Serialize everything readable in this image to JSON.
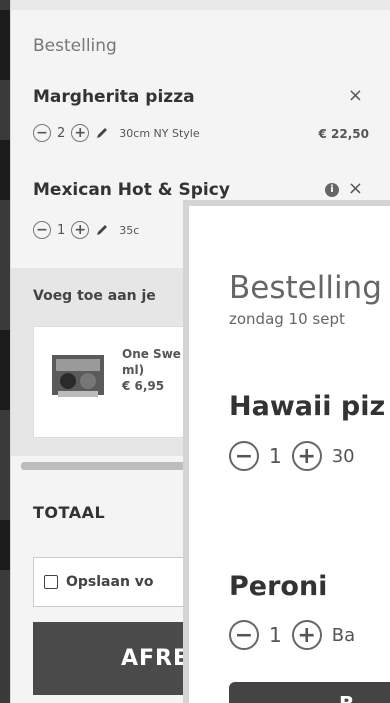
{
  "order": {
    "title": "Bestelling",
    "items": [
      {
        "name": "Margherita pizza",
        "remove": "×",
        "qty": "2",
        "size": "30cm NY Style",
        "price": "€ 22,50",
        "minus": "−",
        "plus": "+"
      },
      {
        "name": "Mexican Hot & Spicy",
        "remove": "×",
        "info": "i",
        "qty": "1",
        "size": "35c",
        "minus": "−",
        "plus": "+"
      }
    ]
  },
  "upsell": {
    "title": "Voeg toe aan je",
    "product": {
      "name_line1": "One Swe",
      "name_line2": "ml)",
      "price": "€ 6,95"
    }
  },
  "total": {
    "label": "TOTAAL"
  },
  "save": {
    "label": "Opslaan vo"
  },
  "checkout": {
    "label": "AFRE"
  },
  "modal": {
    "title": "Bestelling",
    "date": "zondag 10 sept",
    "items": [
      {
        "name": "Hawaii piz",
        "qty": "1",
        "extra": "30",
        "minus": "−",
        "plus": "+"
      },
      {
        "name": "Peroni",
        "qty": "1",
        "extra": "Ba",
        "minus": "−",
        "plus": "+"
      }
    ],
    "button_label": "B"
  },
  "icons": {
    "edit": "pencil-icon",
    "close": "close-icon",
    "info": "info-icon",
    "checkbox": "checkbox-icon"
  }
}
